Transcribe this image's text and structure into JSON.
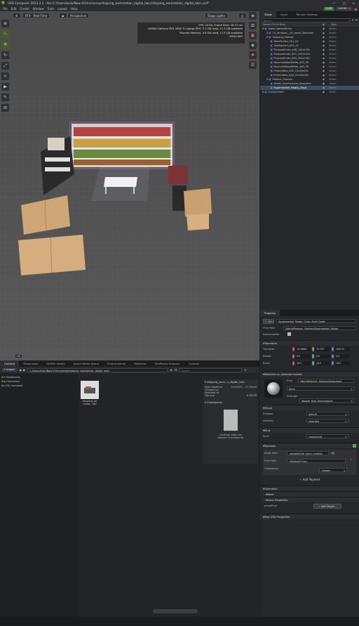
{
  "app": {
    "title": "USD Composer   2023.2.5  -  file:/C:/Users/kuilu/New E/Omniverse/shipping_workstation_digital_twin/shipping_workstation_digital_twin.usd*",
    "live_label": "LIVE",
    "cache_label": "CACHE: "
  },
  "menu": [
    "File",
    "Edit",
    "Create",
    "Window",
    "Tools",
    "Layout",
    "Help"
  ],
  "viewport": {
    "render_mode": "RTX - Real-Time",
    "camera": "Perspective",
    "stage_lights": "Stage Lights",
    "stats": [
      "FPS: 52.85, Frame time: 18.57 ms",
      "NVIDIA GeForce RTX 3080 Ti Laptop GPU: 3.7 GB used, 11.3 GB available",
      "Process Memory: 4.6 GB used, 17.5 GB available",
      "943x1463"
    ],
    "unit_badge": "cm"
  },
  "content": {
    "tabs": [
      "Content",
      "Showcases",
      "NVIDIA Assets",
      "Asset Stores (beta)",
      "Environments",
      "Materials",
      "SimReady Explorer",
      "Console"
    ],
    "import_label": "+ Import",
    "path": "C:/Users/kuilu/New E/Omniverse/shipping_workstation_digital_twin/",
    "search_placeholder": "Search",
    "tree": [
      "Bookmarks",
      "Omniverse",
      "My Computer"
    ],
    "file_name": "shipping_workstation.usd",
    "file_name_display": "shipping_wo rkstat...usd",
    "details_title": "shipping_work...n_digital_twin",
    "details": [
      [
        "Date Modified",
        "10/16/20... 01:55AM"
      ],
      [
        "Created by",
        ""
      ],
      [
        "Modified by",
        ""
      ],
      [
        "File size",
        "8.88 KB"
      ]
    ],
    "checkpoints_title": "Checkpoints",
    "checkpoints_msg1": "Location does not",
    "checkpoints_msg2": "support Checkpoints."
  },
  "stage": {
    "tabs": [
      "Stage",
      "Layer",
      "Render Settings"
    ],
    "search_placeholder": "Search",
    "col_name": "Name (Old to New)",
    "col_type": "Type",
    "rows": [
      {
        "indent": 0,
        "label": "World (defaultPrim)",
        "type": "Xform",
        "sel": false
      },
      {
        "indent": 1,
        "label": "CS_Ambient__SH_stand_Workstat",
        "type": "Xform",
        "sel": false
      },
      {
        "indent": 1,
        "label": "Shipping_Utilities",
        "type": "Xform",
        "sel": false
      },
      {
        "indent": 2,
        "label": "TableTrolley_C01_01",
        "type": "Xform",
        "sel": false
      },
      {
        "indent": 2,
        "label": "ToolBoxCart_A02_01",
        "type": "Xform",
        "sel": false
      },
      {
        "indent": 2,
        "label": "PlywoodCrate_A08_120x120x",
        "type": "Xform",
        "sel": false
      },
      {
        "indent": 2,
        "label": "PlywoodCrate_B01_100x100x",
        "type": "Xform",
        "sel": false
      },
      {
        "indent": 2,
        "label": "PlywoodCrate_B04_200x100x",
        "type": "Xform",
        "sel": false
      },
      {
        "indent": 2,
        "label": "RecycledWoodPallet_A02_PR",
        "type": "Xform",
        "sel": false
      },
      {
        "indent": 2,
        "label": "RecycledWoodPallet_A02_PR",
        "type": "Xform",
        "sel": false
      },
      {
        "indent": 2,
        "label": "PrimeroBox_A05_22x28x25c",
        "type": "Xform",
        "sel": false
      },
      {
        "indent": 2,
        "label": "PrimeroBox_A04_22x28x25c",
        "type": "Xform",
        "sel": false
      },
      {
        "indent": 1,
        "label": "Product_Shelves",
        "type": "Xform",
        "sel": false
      },
      {
        "indent": 2,
        "label": "Model_Supermarket_Assortme",
        "type": "Xform",
        "sel": false
      },
      {
        "indent": 2,
        "label": "Supermarket_Potato_Chips",
        "type": "Xform",
        "sel": true
      },
      {
        "indent": 0,
        "label": "Environment",
        "type": "Xform",
        "sel": false
      }
    ]
  },
  "property": {
    "title": "Property",
    "add_label": "+ Add",
    "prim_name": "Supermarket_Potato_Chips_Shelf_Asset",
    "prim_path_label": "Prim Path",
    "prim_path": "/World/Product_Shelves/Supermarket_Potato",
    "instanceable_label": "Instanceable",
    "transform_title": "Transform",
    "translate_label": "Translate",
    "translate": [
      "-61.6864",
      "33.725",
      "-650.25"
    ],
    "rotate_label": "Rotate",
    "rotate": [
      "0.0",
      "0.0",
      "0.0"
    ],
    "scale_label": "Scale",
    "scale": [
      "16.0",
      "16.0",
      "16.0"
    ],
    "materials_title": "Materials on selected models",
    "prim_label": "Prim",
    "material_prim": "/World/Product_Shelves/Supermark",
    "material_none": "None",
    "strength_label": "Strength",
    "strength_value": "Weaker than Descendants",
    "visual_title": "Visual",
    "purpose_label": "Purpose",
    "purpose": "default",
    "visibility_label": "Visibility",
    "visibility": "inherited",
    "kind_title": "Kind",
    "kind_label": "Kind",
    "kind": "component",
    "payloads_title": "Payloads",
    "asset_path_label": "Asset Path",
    "asset_path": "./assets/third_party_models/",
    "payload_prim_label": "Prim Path",
    "payload_prim": "<Default Prim>",
    "checkpoint_label": "Checkpoint",
    "checkpoint": "<head>",
    "add_payload": "Add Payload",
    "geometry_title": "Geometry",
    "mesh_title": "Mesh",
    "extra_title": "Extra Properties",
    "proxyprim_label": "proxyPrim",
    "add_target": "Add Target...",
    "raw_title": "Raw USD Properties"
  }
}
